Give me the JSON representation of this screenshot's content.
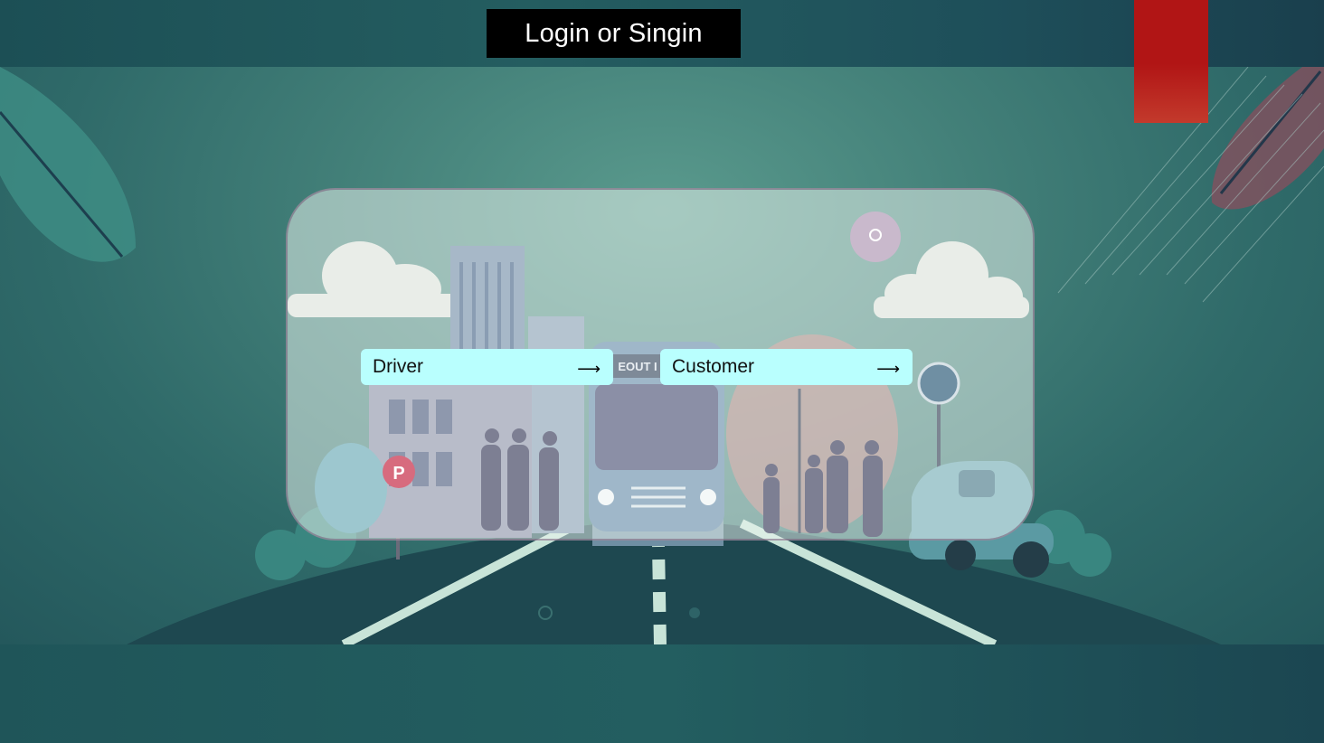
{
  "header": {
    "title": "Login or Singin"
  },
  "roles": [
    {
      "label": "Driver",
      "arrow": "⟶"
    },
    {
      "label": "Customer",
      "arrow": "⟶"
    }
  ],
  "illustration": {
    "bus_sign": "EOUT I",
    "parking_sign": "P"
  },
  "colors": {
    "title_bg": "#000000",
    "button_bg": "#b9fffe",
    "accent_red": "#b11515",
    "background_teal": "#2f6a69"
  }
}
